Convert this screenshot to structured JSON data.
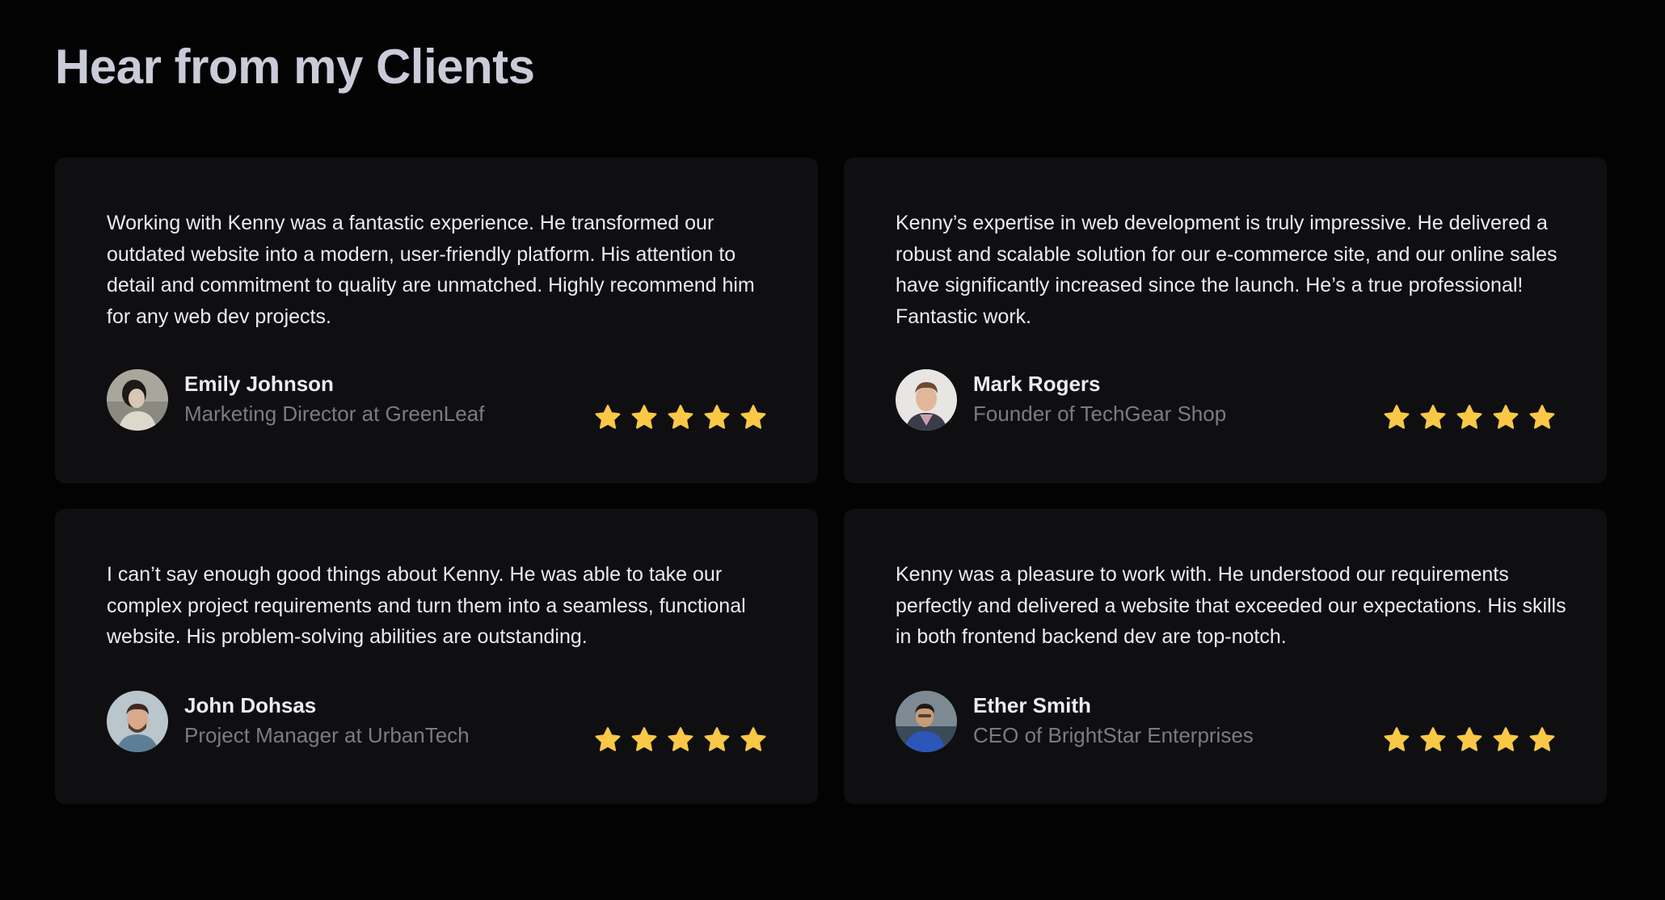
{
  "section": {
    "title": "Hear from my Clients"
  },
  "colors": {
    "background": "#030304",
    "card": "#0f0f11",
    "star": "#f9c846",
    "title": "#c9cbd8",
    "role": "#7b7b82"
  },
  "testimonials": [
    {
      "quote": "Working with Kenny was a fantastic experience. He transformed our outdated website into a modern, user-friendly platform. His attention to detail and commitment to quality are unmatched. Highly recommend him for any web dev projects.",
      "name": "Emily Johnson",
      "role": "Marketing Director at GreenLeaf",
      "rating": 5,
      "avatar_icon": "woman-portrait"
    },
    {
      "quote": "Kenny’s expertise in web development is truly impressive. He delivered a robust and scalable solution for our e-commerce site, and our online sales have significantly increased since the launch. He’s a true professional! Fantastic work.",
      "name": "Mark Rogers",
      "role": "Founder of TechGear Shop",
      "rating": 5,
      "avatar_icon": "man-portrait"
    },
    {
      "quote": "I can’t say enough good things about Kenny. He was able to take our complex project requirements and turn them into a seamless, functional website. His problem-solving abilities are outstanding.",
      "name": "John Dohsas",
      "role": "Project Manager at UrbanTech",
      "rating": 5,
      "avatar_icon": "man-portrait"
    },
    {
      "quote": "Kenny was a pleasure to work with. He understood our requirements perfectly and delivered a website that exceeded our expectations. His skills in both frontend backend dev are top-notch.",
      "name": "Ether Smith",
      "role": "CEO of BrightStar Enterprises",
      "rating": 5,
      "avatar_icon": "man-portrait"
    }
  ]
}
